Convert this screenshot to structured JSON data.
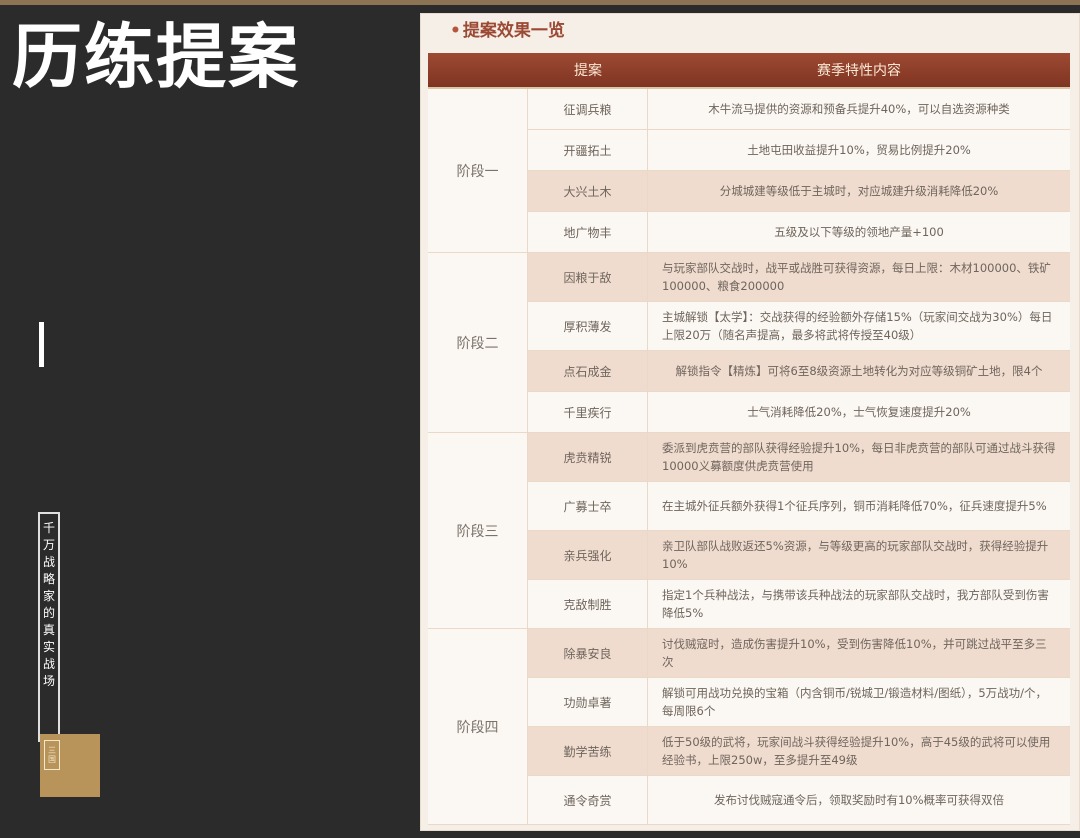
{
  "slide": {
    "title": "历练提案",
    "vertical_caption": [
      "千",
      "万",
      "战",
      "略",
      "家",
      "的",
      "真",
      "实",
      "战",
      "场"
    ],
    "seal_text": [
      "三",
      "国"
    ]
  },
  "panel": {
    "heading_bullet": "•",
    "heading": "提案效果一览",
    "columns": [
      "提案",
      "赛季特性内容"
    ],
    "stages": [
      {
        "label": "阶段一",
        "rows": [
          {
            "name": "征调兵粮",
            "content": "木牛流马提供的资源和预备兵提升40%，可以自选资源种类"
          },
          {
            "name": "开疆拓土",
            "content": "土地屯田收益提升10%，贸易比例提升20%"
          },
          {
            "name": "大兴土木",
            "content": "分城城建等级低于主城时，对应城建升级消耗降低20%"
          },
          {
            "name": "地广物丰",
            "content": "五级及以下等级的领地产量+100"
          }
        ]
      },
      {
        "label": "阶段二",
        "rows": [
          {
            "name": "因粮于敌",
            "content": "与玩家部队交战时，战平或战胜可获得资源，每日上限：木材100000、铁矿100000、粮食200000"
          },
          {
            "name": "厚积薄发",
            "content": "主城解锁【太学】：交战获得的经验额外存储15%（玩家间交战为30%）每日上限20万（随名声提高，最多将武将传授至40级）"
          },
          {
            "name": "点石成金",
            "content": "解锁指令【精炼】可将6至8级资源土地转化为对应等级铜矿土地，限4个"
          },
          {
            "name": "千里疾行",
            "content": "士气消耗降低20%，士气恢复速度提升20%"
          }
        ]
      },
      {
        "label": "阶段三",
        "rows": [
          {
            "name": "虎贲精锐",
            "content": "委派到虎贲营的部队获得经验提升10%，每日非虎贲营的部队可通过战斗获得10000义募额度供虎贲营使用"
          },
          {
            "name": "广募士卒",
            "content": "在主城外征兵额外获得1个征兵序列，铜币消耗降低70%，征兵速度提升5%"
          },
          {
            "name": "亲兵强化",
            "content": "亲卫队部队战败返还5%资源，与等级更高的玩家部队交战时，获得经验提升10%"
          },
          {
            "name": "克敌制胜",
            "content": "指定1个兵种战法，与携带该兵种战法的玩家部队交战时，我方部队受到伤害降低5%"
          }
        ]
      },
      {
        "label": "阶段四",
        "rows": [
          {
            "name": "除暴安良",
            "content": "讨伐贼寇时，造成伤害提升10%，受到伤害降低10%，并可跳过战平至多三次"
          },
          {
            "name": "功勋卓著",
            "content": "解锁可用战功兑换的宝箱（内含铜币/锐城卫/锻造材料/图纸），5万战功/个，每周限6个"
          },
          {
            "name": "勤学苦练",
            "content": "低于50级的武将，玩家间战斗获得经验提升10%，高于45级的武将可以使用经验书，上限250w，至多提升至49级"
          },
          {
            "name": "通令奇赏",
            "content": "发布讨伐贼寇通令后，领取奖励时有10%概率可获得双倍"
          }
        ]
      }
    ]
  }
}
